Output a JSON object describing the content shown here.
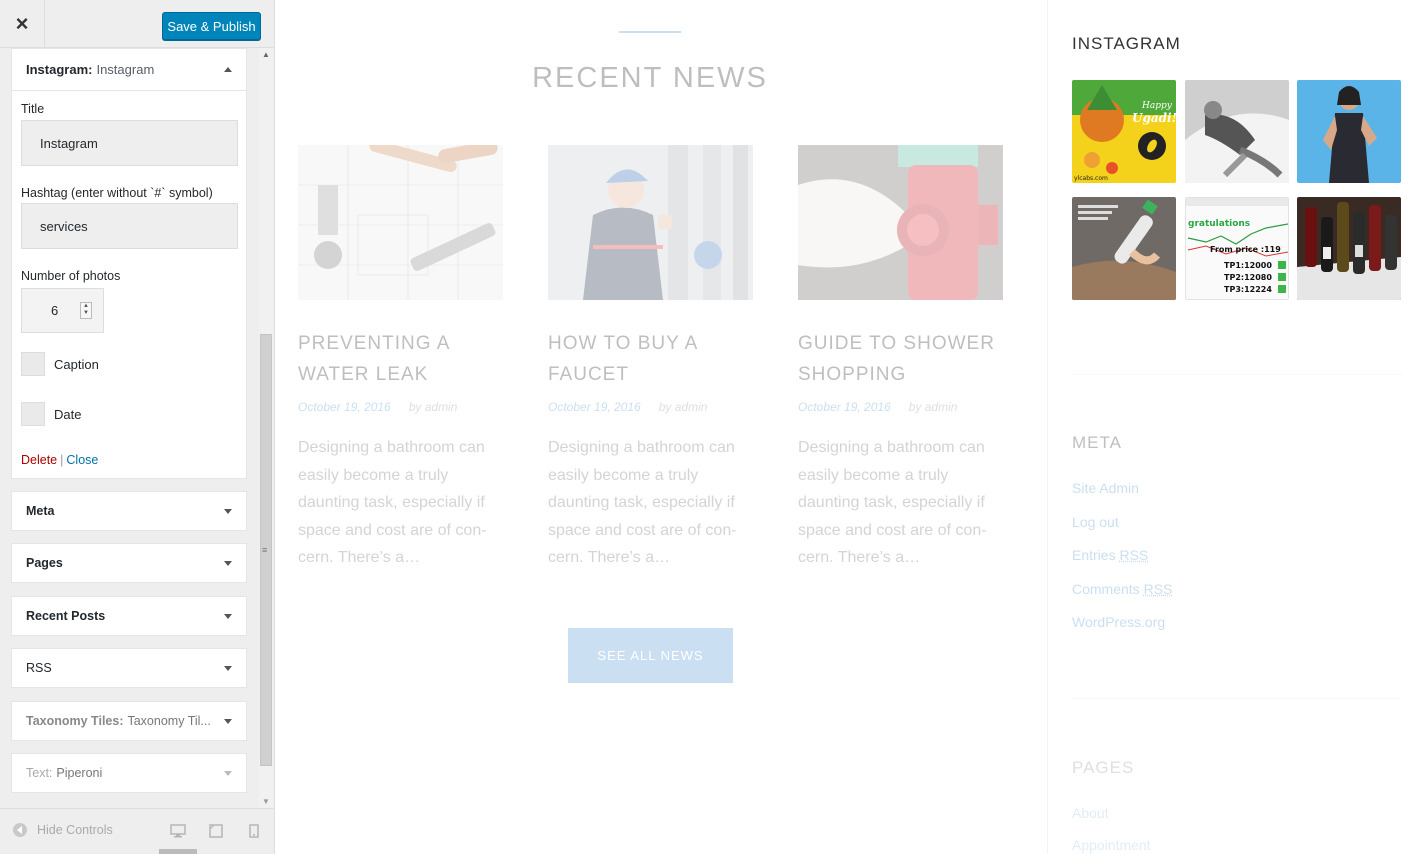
{
  "customizer": {
    "close_label": "×",
    "publish_label": "Save & Publish",
    "instagram_widget": {
      "title_prefix": "Instagram:",
      "title_name": "Instagram",
      "fields": {
        "title_label": "Title",
        "title_value": "Instagram",
        "hashtag_label": "Hashtag (enter without `#` symbol)",
        "hashtag_value": "services",
        "photos_label": "Number of photos",
        "photos_value": "6",
        "caption_label": "Caption",
        "date_label": "Date"
      },
      "delete_label": "Delete",
      "separator": "|",
      "close_label": "Close"
    },
    "collapsed_widgets": [
      {
        "name": "Meta",
        "sub": ""
      },
      {
        "name": "Pages",
        "sub": ""
      },
      {
        "name": "Recent Posts",
        "sub": ""
      },
      {
        "name": "RSS",
        "sub": ""
      },
      {
        "name": "Taxonomy Tiles:",
        "sub": "Taxonomy Til..."
      },
      {
        "name": "Text:",
        "sub": "Piperoni"
      }
    ],
    "footer": {
      "hide_controls": "Hide Controls"
    }
  },
  "preview": {
    "recent_news": {
      "title": "RECENT NEWS",
      "posts": [
        {
          "title": "PREVENTING A WATER LEAK",
          "date": "October 19, 2016",
          "author": "by admin",
          "excerpt": "Designing a bathroom can easily become a truly daunting task, especially if space and cost are of con-cern. There’s a…"
        },
        {
          "title": "HOW TO BUY A FAUCET",
          "date": "October 19, 2016",
          "author": "by admin",
          "excerpt": "Designing a bathroom can easily become a truly daunting task, especially if space and cost are of con-cern. There’s a…"
        },
        {
          "title": "GUIDE TO SHOWER SHOPPING",
          "date": "October 19, 2016",
          "author": "by admin",
          "excerpt": "Designing a bathroom can easily become a truly daunting task, especially if space and cost are of con-cern. There’s a…"
        }
      ],
      "button": "SEE ALL NEWS"
    },
    "instagram": {
      "title": "INSTAGRAM",
      "tile_text": {
        "ugadi": "Happy Ugadi!",
        "caption_corner": "ylcabs.com",
        "trade_head": "gratulations",
        "trade_price": "From price :119",
        "trade_tp1": "TP1:12000",
        "trade_tp2": "TP2:12080",
        "trade_tp3": "TP3:12224"
      }
    },
    "meta": {
      "title": "META",
      "links": [
        "Site Admin",
        "Log out",
        "Entries",
        "Comments",
        "WordPress.org"
      ],
      "rss": "RSS"
    },
    "pages": {
      "title": "PAGES",
      "links": [
        "About",
        "Appointment"
      ]
    }
  },
  "colors": {
    "publish": "#0085ba",
    "accent": "#5b9bd5",
    "delete": "#aa0000",
    "link": "#0073aa"
  }
}
